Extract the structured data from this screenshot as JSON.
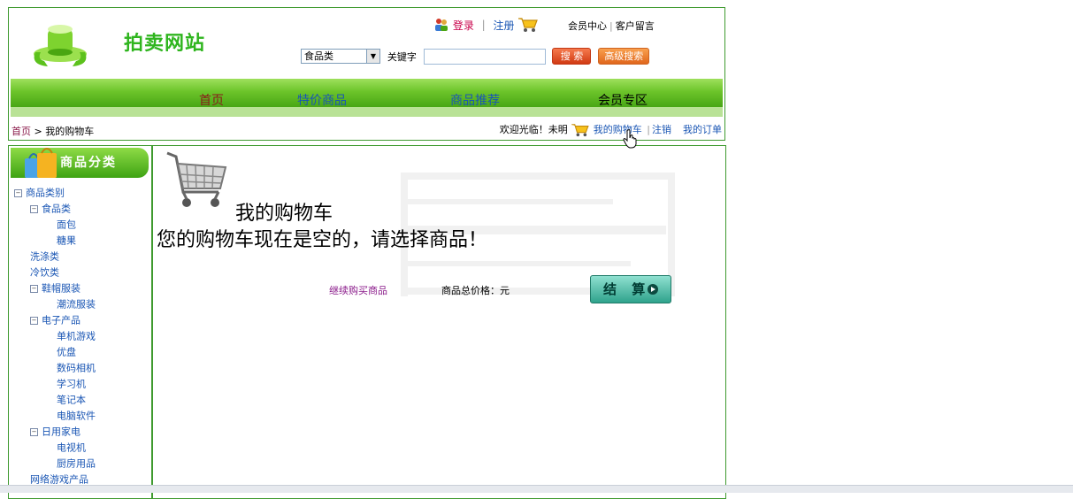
{
  "colors": {
    "accent_green": "#3ea313",
    "border_green": "#3f9a2f",
    "link_blue": "#1a56b4",
    "logo_green": "#2fb51e",
    "checkout_teal": "#2fa38c"
  },
  "header": {
    "site_name": "拍卖网站",
    "top_links": {
      "login": "登录",
      "register": "注册",
      "member_center": "会员中心",
      "guestbook": "客户留言"
    },
    "search": {
      "category_selected": "食品类",
      "keyword_label": "关键字",
      "keyword_value": "",
      "search_button": "搜 索",
      "advanced_button": "高级搜索"
    },
    "nav": [
      "首页",
      "特价商品",
      "商品推荐",
      "会员专区"
    ],
    "breadcrumb": {
      "home": "首页",
      "current": " > 我的购物车"
    },
    "welcome": {
      "greeting": "欢迎光临！未明",
      "my_cart": "我的购物车",
      "logout": "注销",
      "my_orders": "我的订单"
    }
  },
  "sidebar": {
    "title": "商品分类",
    "tree": [
      {
        "label": "商品类别",
        "level": 0,
        "toggle": "−"
      },
      {
        "label": "食品类",
        "level": 1,
        "toggle": "−"
      },
      {
        "label": "面包",
        "level": 2
      },
      {
        "label": "糖果",
        "level": 2
      },
      {
        "label": "洗涤类",
        "level": 1
      },
      {
        "label": "冷饮类",
        "level": 1
      },
      {
        "label": "鞋帽服装",
        "level": 1,
        "toggle": "−"
      },
      {
        "label": "潮流服装",
        "level": 2
      },
      {
        "label": "电子产品",
        "level": 1,
        "toggle": "−"
      },
      {
        "label": "单机游戏",
        "level": 2
      },
      {
        "label": "优盘",
        "level": 2
      },
      {
        "label": "数码相机",
        "level": 2
      },
      {
        "label": "学习机",
        "level": 2
      },
      {
        "label": "笔记本",
        "level": 2
      },
      {
        "label": "电脑软件",
        "level": 2
      },
      {
        "label": "日用家电",
        "level": 1,
        "toggle": "−"
      },
      {
        "label": "电视机",
        "level": 2
      },
      {
        "label": "厨房用品",
        "level": 2
      },
      {
        "label": "网络游戏产品",
        "level": 1
      }
    ]
  },
  "main": {
    "cart_title": "我的购物车",
    "empty_message": "您的购物车现在是空的，请选择商品！",
    "continue_shopping": "继续购买商品",
    "total_label": "商品总价格：元",
    "checkout_button": "结 算"
  }
}
